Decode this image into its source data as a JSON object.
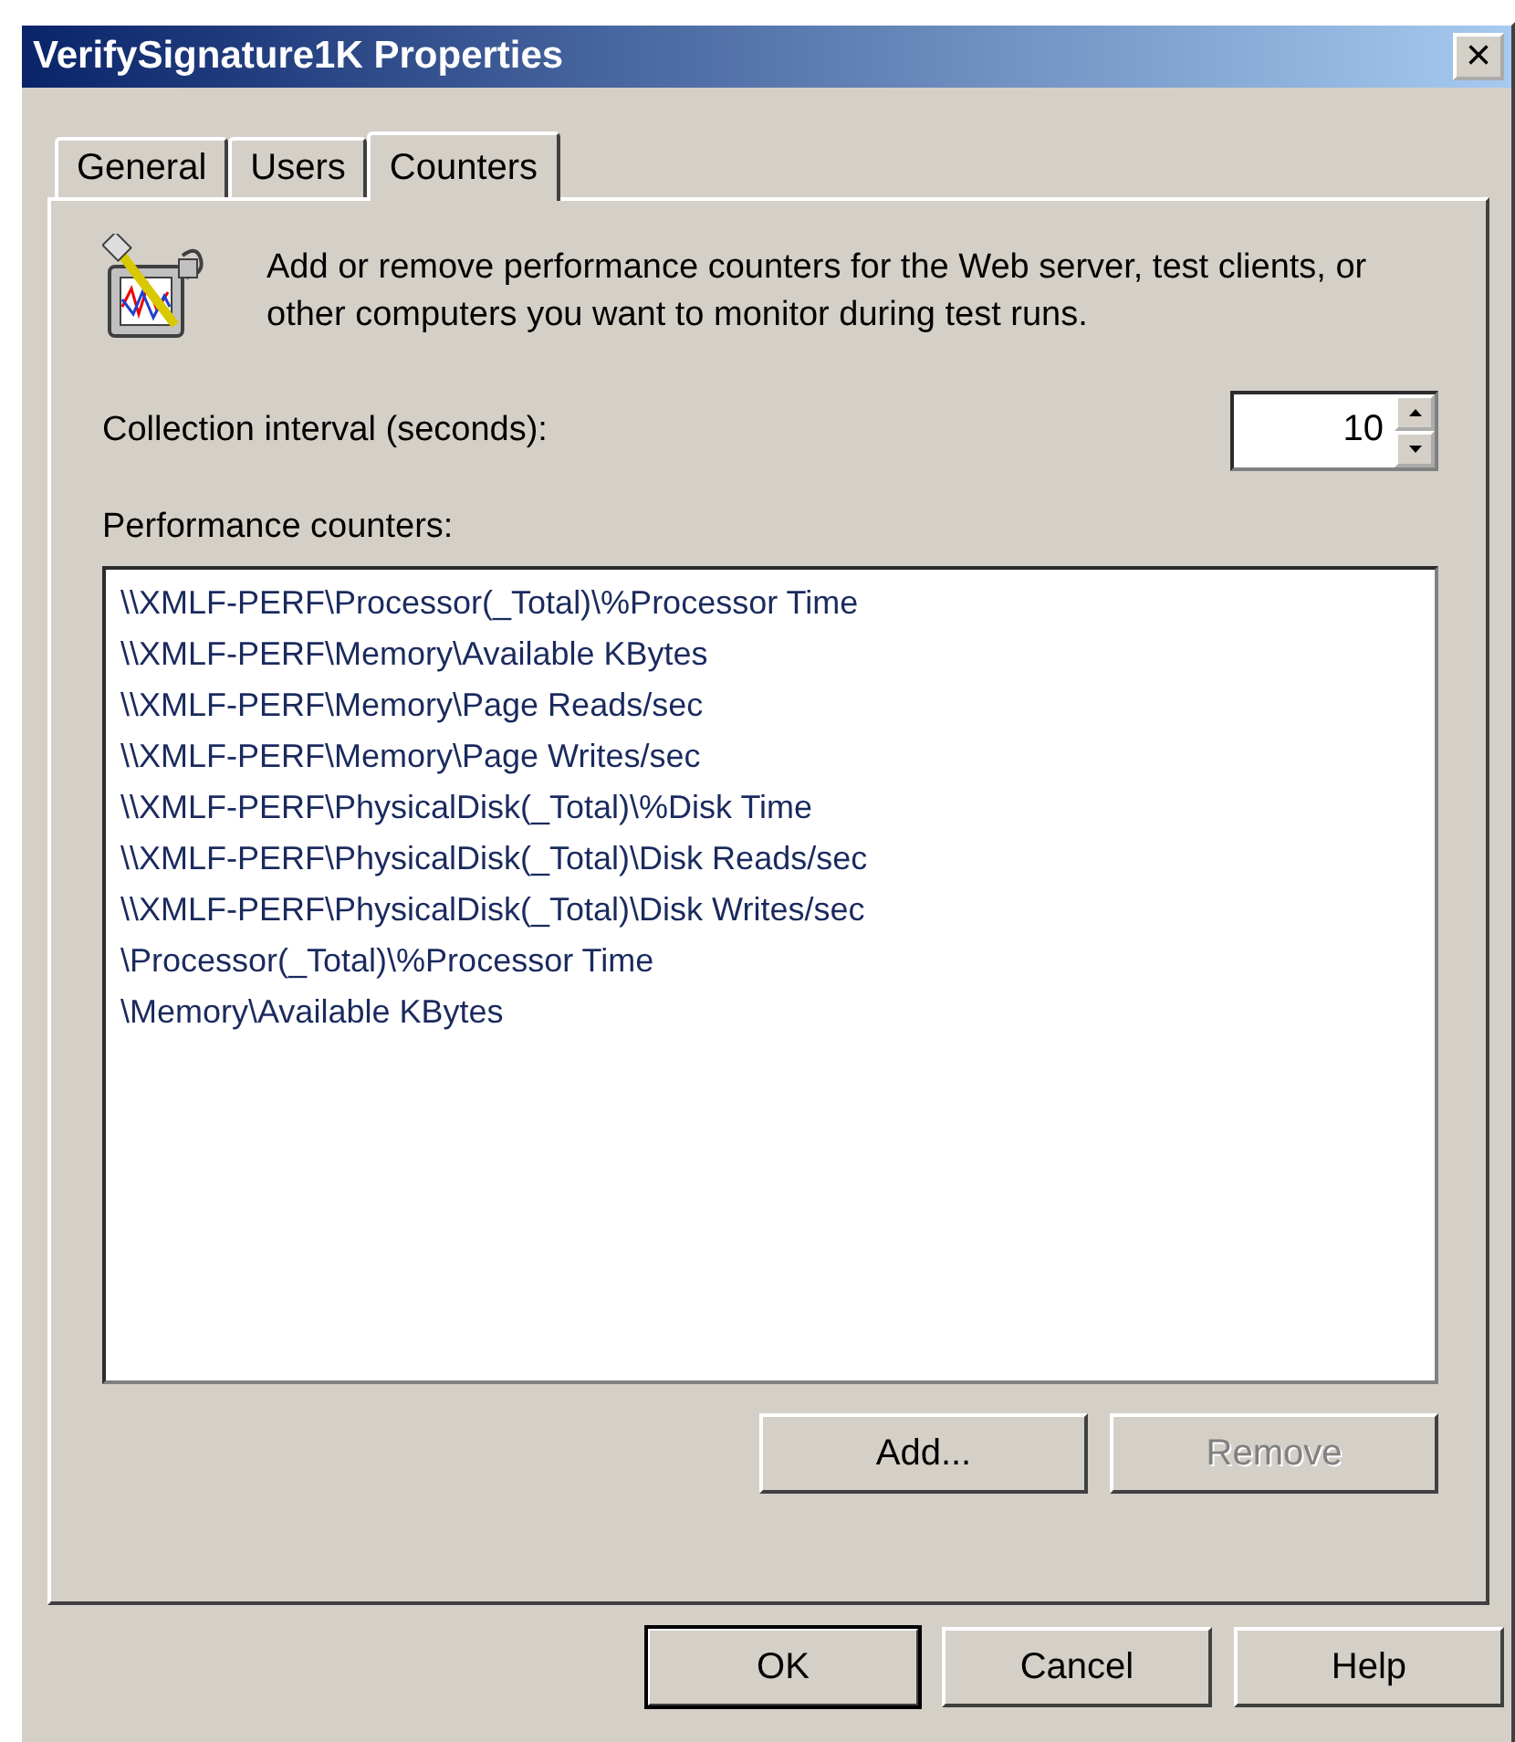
{
  "window": {
    "title": "VerifySignature1K Properties",
    "close": "×"
  },
  "tabs": [
    {
      "label": "General",
      "selected": false
    },
    {
      "label": "Users",
      "selected": false
    },
    {
      "label": "Counters",
      "selected": true
    }
  ],
  "description": "Add or remove performance counters for the Web server, test clients, or other computers you want to monitor during test runs.",
  "interval": {
    "label": "Collection interval (seconds):",
    "value": "10"
  },
  "counters": {
    "label": "Performance counters:",
    "items": [
      "\\\\XMLF-PERF\\Processor(_Total)\\%Processor Time",
      "\\\\XMLF-PERF\\Memory\\Available KBytes",
      "\\\\XMLF-PERF\\Memory\\Page Reads/sec",
      "\\\\XMLF-PERF\\Memory\\Page Writes/sec",
      "\\\\XMLF-PERF\\PhysicalDisk(_Total)\\%Disk Time",
      "\\\\XMLF-PERF\\PhysicalDisk(_Total)\\Disk Reads/sec",
      "\\\\XMLF-PERF\\PhysicalDisk(_Total)\\Disk Writes/sec",
      "\\Processor(_Total)\\%Processor Time",
      "\\Memory\\Available KBytes"
    ]
  },
  "list_buttons": [
    {
      "label": "Add...",
      "disabled": false
    },
    {
      "label": "Remove",
      "disabled": true
    }
  ],
  "dialog_buttons": [
    {
      "label": "OK",
      "default": true
    },
    {
      "label": "Cancel",
      "default": false
    },
    {
      "label": "Help",
      "default": false
    }
  ]
}
